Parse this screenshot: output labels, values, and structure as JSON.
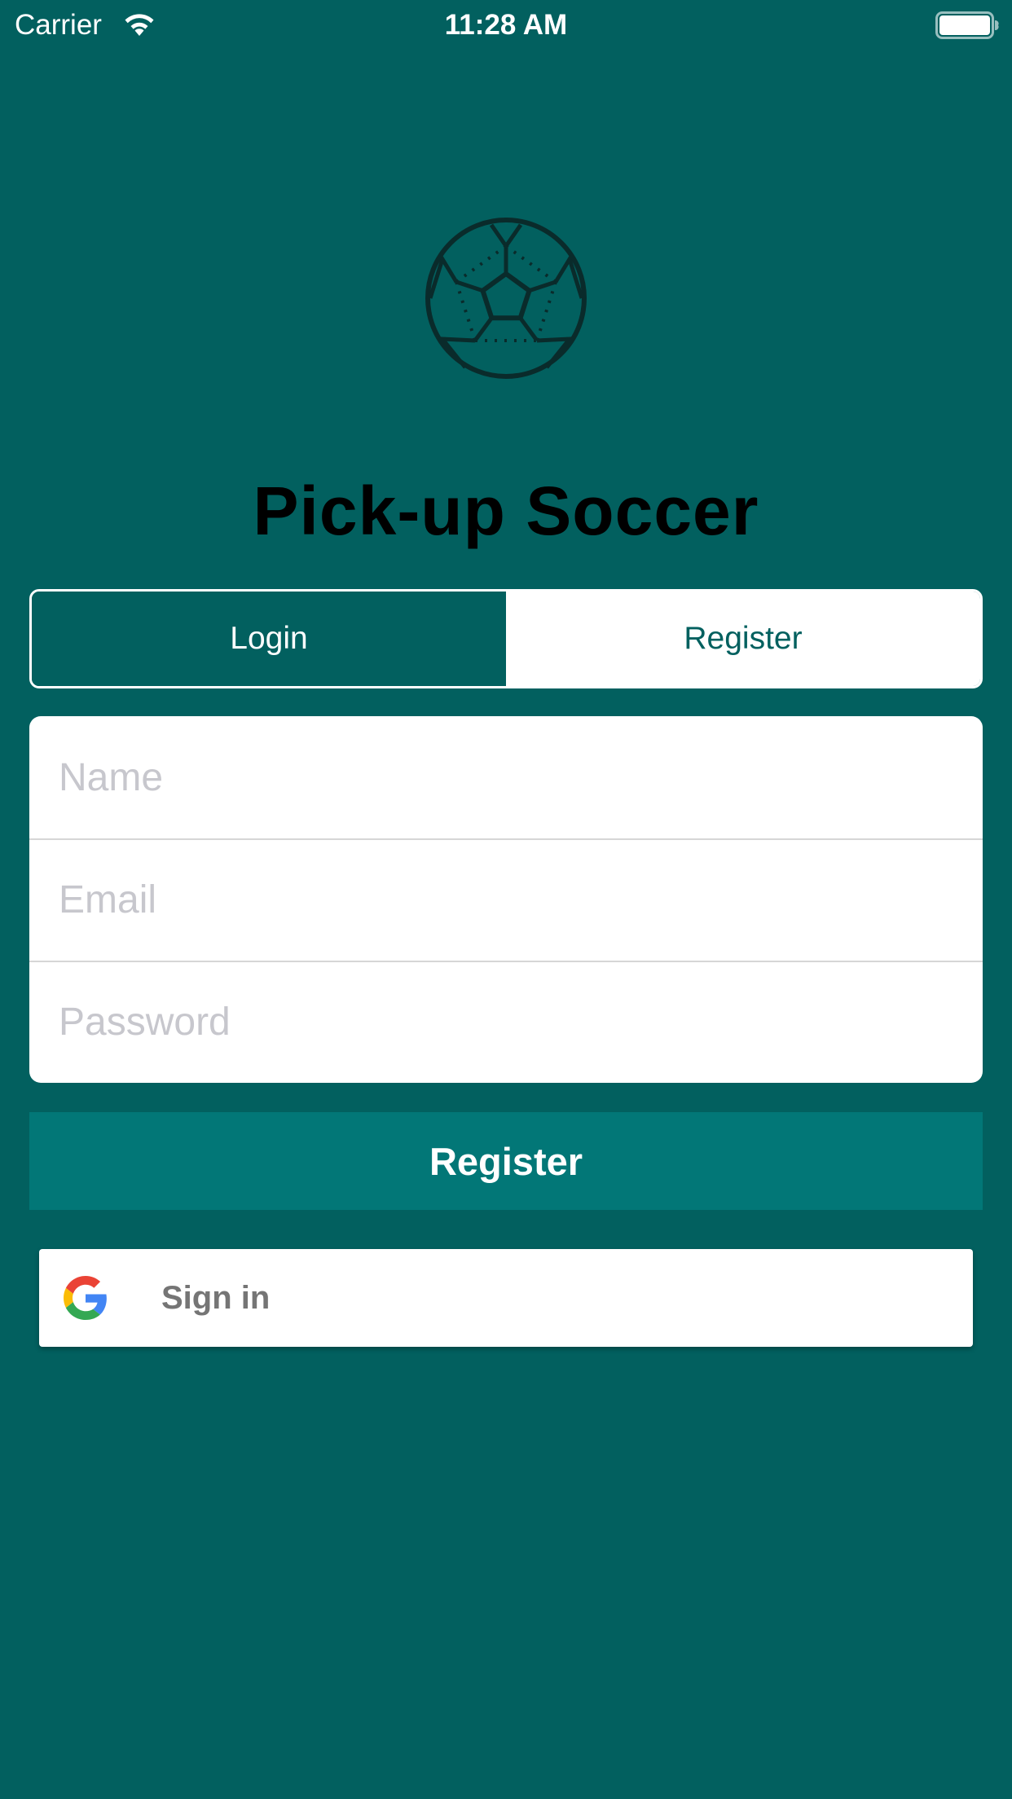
{
  "status_bar": {
    "carrier": "Carrier",
    "time": "11:28 AM",
    "icons": [
      "wifi-icon",
      "battery-icon"
    ]
  },
  "app": {
    "logo_icon": "soccer-ball-icon",
    "title": "Pick-up Soccer"
  },
  "segmented": {
    "login_label": "Login",
    "register_label": "Register",
    "selected": "Register"
  },
  "form": {
    "name_placeholder": "Name",
    "name_value": "",
    "email_placeholder": "Email",
    "email_value": "",
    "password_placeholder": "Password",
    "password_value": ""
  },
  "submit_button": {
    "label": "Register"
  },
  "google_signin": {
    "icon": "google-g-icon",
    "label": "Sign in"
  },
  "colors": {
    "background": "#02605F",
    "accent_button": "#027777",
    "title_text": "#000000",
    "placeholder": "#C7C7CD",
    "google_label": "#757575"
  }
}
